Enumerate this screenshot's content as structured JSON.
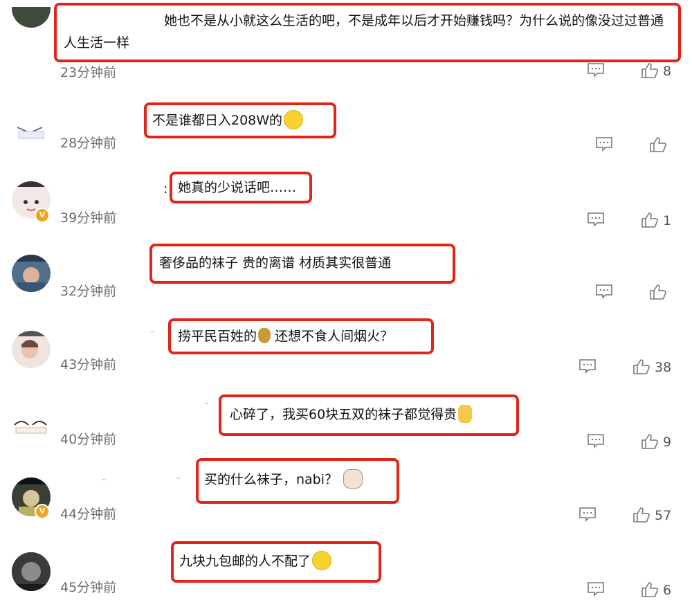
{
  "comments": [
    {
      "text": "她也不是从小就这么生活的吧，不是成年以后才开始赚钱吗？为什么说的像没过过普通人生活一样",
      "time": "23分钟前",
      "likes": "8",
      "emoji": ""
    },
    {
      "text": "不是谁都日入208W的",
      "time": "28分钟前",
      "likes": "",
      "emoji": "smile-emoji"
    },
    {
      "prefix": ":",
      "text": "她真的少说话吧……",
      "time": "39分钟前",
      "likes": "1",
      "emoji": ""
    },
    {
      "text": "奢侈品的袜子 贵的离谱 材质其实很普通",
      "time": "32分钟前",
      "likes": "",
      "emoji": ""
    },
    {
      "text": "捞平民百姓的",
      "text2": "还想不食人间烟火？",
      "time": "43分钟前",
      "likes": "38",
      "emoji": "money-bag-emoji"
    },
    {
      "text": "心碎了，我买60块五双的袜子都觉得贵",
      "time": "40分钟前",
      "likes": "9",
      "emoji": "sweat-emoji"
    },
    {
      "text": "买的什么袜子，nabi？",
      "time": "44分钟前",
      "likes": "57",
      "emoji": "cat-emoji"
    },
    {
      "text": "九块九包邮的人不配了",
      "time": "45分钟前",
      "likes": "6",
      "emoji": "rolling-eyes-emoji"
    }
  ],
  "colors": {
    "highlight_border": "#e1251b",
    "timestamp": "#6b6b6b",
    "badge": "#f2a31b"
  },
  "icons": {
    "comment": "comment-icon",
    "like": "thumbs-up-icon",
    "verified": "verified-badge-icon"
  }
}
